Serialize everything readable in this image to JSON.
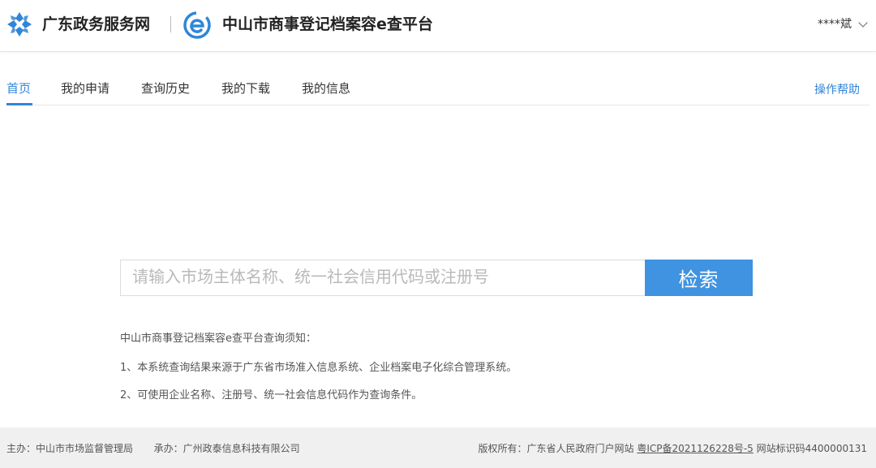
{
  "header": {
    "site_name": "广东政务服务网",
    "platform_name": "中山市商事登记档案容e查平台",
    "user_name": "****斌"
  },
  "nav": {
    "tabs": [
      {
        "label": "首页",
        "active": true
      },
      {
        "label": "我的申请",
        "active": false
      },
      {
        "label": "查询历史",
        "active": false
      },
      {
        "label": "我的下载",
        "active": false
      },
      {
        "label": "我的信息",
        "active": false
      }
    ],
    "help_label": "操作帮助"
  },
  "search": {
    "placeholder": "请输入市场主体名称、统一社会信用代码或注册号",
    "value": "",
    "button_label": "检索"
  },
  "notice": {
    "title": "中山市商事登记档案容e查平台查询须知：",
    "items": [
      "1、本系统查询结果来源于广东省市场准入信息系统、企业档案电子化综合管理系统。",
      "2、可使用企业名称、注册号、统一社会信息代码作为查询条件。"
    ]
  },
  "footer": {
    "host": "主办：中山市市场监督管理局",
    "organizer": "承办：广州政泰信息科技有限公司",
    "copyright": "版权所有：广东省人民政府门户网站",
    "icp": "粤ICP备2021126228号-5",
    "site_id": "网站标识码4400000131"
  },
  "colors": {
    "accent": "#2f86d8",
    "button": "#3f93e0",
    "footer_bg": "#f0f0f0"
  },
  "icons": [
    "guangdong-gov-logo-icon",
    "e-search-logo-icon",
    "chevron-down-icon"
  ]
}
